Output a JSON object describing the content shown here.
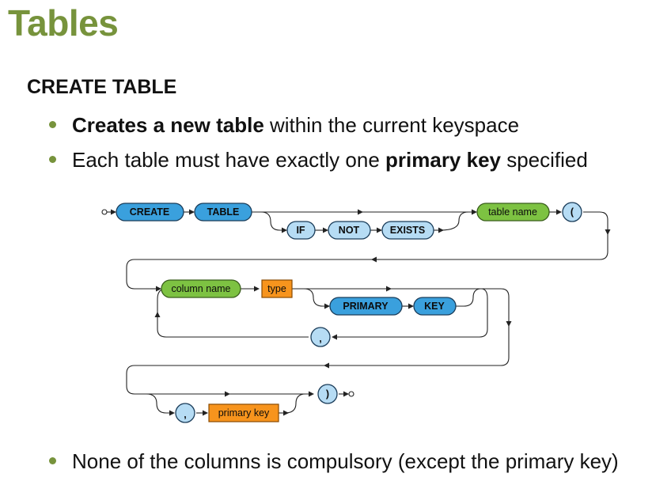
{
  "slide": {
    "title": "Tables",
    "subtitle": "CREATE TABLE",
    "bullet1": {
      "bold": "Creates a new table",
      "rest": " within the current keyspace"
    },
    "bullet2": {
      "pre": "Each table must have exactly one ",
      "bold": "primary key",
      "post": " specified"
    },
    "bullet3": "None of the columns is compulsory (except the primary key)"
  },
  "diagram": {
    "create": "CREATE",
    "table": "TABLE",
    "if": "IF",
    "not": "NOT",
    "exists": "EXISTS",
    "table_name": "table name",
    "open_paren": "(",
    "column_name": "column name",
    "type": "type",
    "primary": "PRIMARY",
    "key": "KEY",
    "comma1": ",",
    "comma2": ",",
    "primary_key": "primary key",
    "close_paren": ")"
  },
  "colors": {
    "title": "#77933c",
    "keyword": "#3aa0dd",
    "optional_keyword": "#b6dcf4",
    "nonterminal": "#7dc242",
    "type": "#f7941d"
  }
}
